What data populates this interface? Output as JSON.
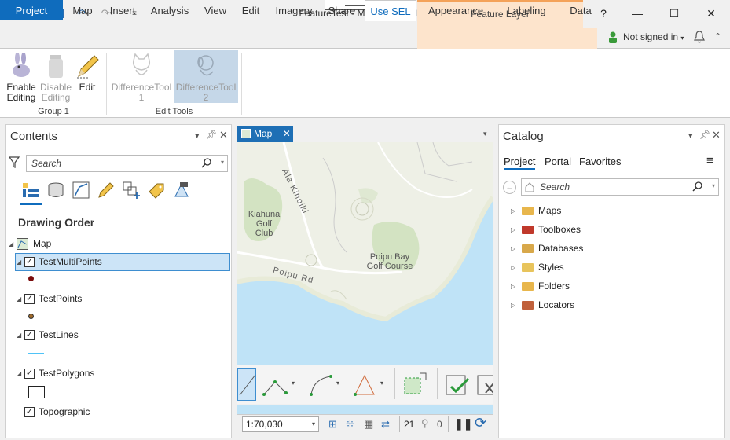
{
  "window": {
    "title": "FeatureTest - Map - ArcGIS Pro",
    "context_header": "Feature Layer"
  },
  "title_buttons": {
    "help": "?",
    "minimize": "—",
    "maximize": "☐",
    "close": "✕"
  },
  "tabs": [
    "Project",
    "Map",
    "Insert",
    "Analysis",
    "View",
    "Edit",
    "Imagery",
    "Share",
    "Use SEL"
  ],
  "context_tabs": [
    "Appearance",
    "Labeling",
    "Data"
  ],
  "account": {
    "status": "Not signed in"
  },
  "ribbon": {
    "group1": {
      "label": "Group 1",
      "buttons": [
        {
          "label1": "Enable",
          "label2": "Editing"
        },
        {
          "label1": "Disable",
          "label2": "Editing"
        },
        {
          "label1": "Edit",
          "label2": ""
        }
      ]
    },
    "edit_tools": {
      "label": "Edit Tools",
      "buttons": [
        {
          "label1": "DifferenceTool",
          "label2": "1"
        },
        {
          "label1": "DifferenceTool",
          "label2": "2"
        }
      ]
    }
  },
  "contents": {
    "title": "Contents",
    "search_placeholder": "Search",
    "section": "Drawing Order",
    "map_label": "Map",
    "layers": [
      {
        "name": "TestMultiPoints"
      },
      {
        "name": "TestPoints"
      },
      {
        "name": "TestLines"
      },
      {
        "name": "TestPolygons"
      },
      {
        "name": "Topographic"
      }
    ]
  },
  "map": {
    "tab_label": "Map",
    "scale": "1:70,030",
    "count": "21",
    "selected": "0",
    "labels": [
      "Ala Kinoiki",
      "Kiahuna",
      "Golf",
      "Club",
      "Poipu Bay",
      "Golf Course",
      "Poipu Rd"
    ]
  },
  "catalog": {
    "title": "Catalog",
    "tabs": [
      "Project",
      "Portal",
      "Favorites"
    ],
    "search_placeholder": "Search",
    "items": [
      "Maps",
      "Toolboxes",
      "Databases",
      "Styles",
      "Folders",
      "Locators"
    ]
  },
  "colors": {
    "accent": "#0f6cbd",
    "context": "#fde4cc",
    "selection": "#cce4f7",
    "water": "#bfe3f7"
  }
}
